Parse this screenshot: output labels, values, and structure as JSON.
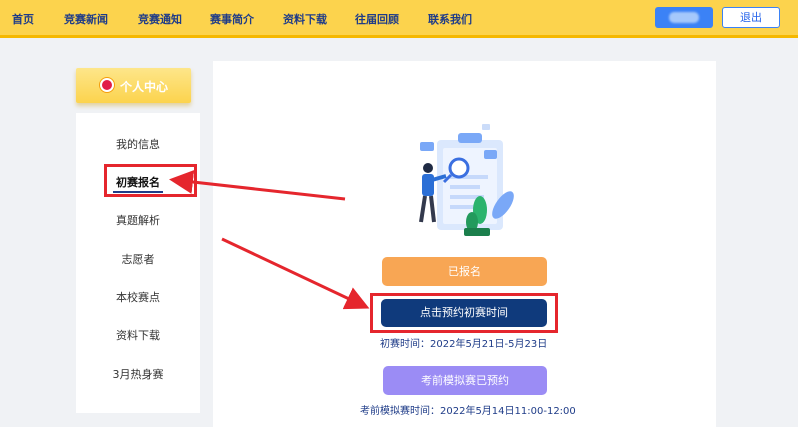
{
  "nav": {
    "items": [
      "首页",
      "竞赛新闻",
      "竞赛通知",
      "赛事简介",
      "资料下载",
      "往届回顾",
      "联系我们"
    ],
    "logout_label": "退出"
  },
  "sidebar": {
    "header": "个人中心",
    "items": [
      "我的信息",
      "初赛报名",
      "真题解析",
      "志愿者",
      "本校赛点",
      "资料下载",
      "3月热身赛"
    ],
    "active_index": 1
  },
  "main": {
    "registered_label": "已报名",
    "book_label": "点击预约初赛时间",
    "prelim_time": "初赛时间：2022年5月21日-5月23日",
    "mock_label": "考前模拟赛已预约",
    "mock_time": "考前模拟赛时间：2022年5月14日11:00-12:00"
  },
  "colors": {
    "nav_bg": "#fcd34d",
    "accent_blue": "#0f3a7c",
    "orange": "#f8a654",
    "purple": "#9b8cf5",
    "annotation_red": "#e5262d"
  }
}
